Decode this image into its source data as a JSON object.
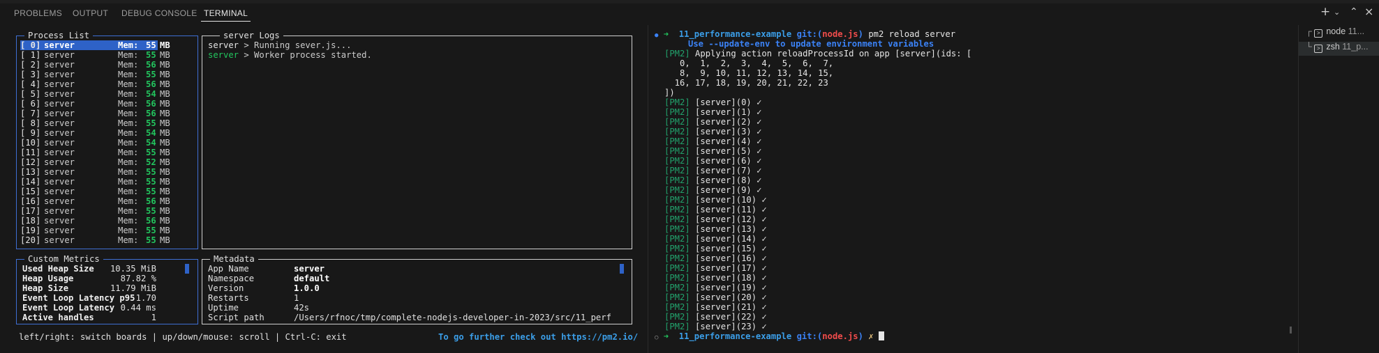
{
  "panel_tabs": [
    "PROBLEMS",
    "OUTPUT",
    "DEBUG CONSOLE",
    "TERMINAL"
  ],
  "top_icons": {
    "add": "+",
    "chevron": "⌄",
    "maximize": "⌃",
    "close": "×"
  },
  "pm2": {
    "process_list": {
      "title": "Process List",
      "rows": [
        {
          "id": "[ 0]",
          "name": "server",
          "mem_label": "Mem:",
          "mem": "55",
          "unit": "MB"
        },
        {
          "id": "[ 1]",
          "name": "server",
          "mem_label": "Mem:",
          "mem": "55",
          "unit": "MB"
        },
        {
          "id": "[ 2]",
          "name": "server",
          "mem_label": "Mem:",
          "mem": "56",
          "unit": "MB"
        },
        {
          "id": "[ 3]",
          "name": "server",
          "mem_label": "Mem:",
          "mem": "55",
          "unit": "MB"
        },
        {
          "id": "[ 4]",
          "name": "server",
          "mem_label": "Mem:",
          "mem": "56",
          "unit": "MB"
        },
        {
          "id": "[ 5]",
          "name": "server",
          "mem_label": "Mem:",
          "mem": "54",
          "unit": "MB"
        },
        {
          "id": "[ 6]",
          "name": "server",
          "mem_label": "Mem:",
          "mem": "56",
          "unit": "MB"
        },
        {
          "id": "[ 7]",
          "name": "server",
          "mem_label": "Mem:",
          "mem": "56",
          "unit": "MB"
        },
        {
          "id": "[ 8]",
          "name": "server",
          "mem_label": "Mem:",
          "mem": "55",
          "unit": "MB"
        },
        {
          "id": "[ 9]",
          "name": "server",
          "mem_label": "Mem:",
          "mem": "54",
          "unit": "MB"
        },
        {
          "id": "[10]",
          "name": "server",
          "mem_label": "Mem:",
          "mem": "54",
          "unit": "MB"
        },
        {
          "id": "[11]",
          "name": "server",
          "mem_label": "Mem:",
          "mem": "55",
          "unit": "MB"
        },
        {
          "id": "[12]",
          "name": "server",
          "mem_label": "Mem:",
          "mem": "52",
          "unit": "MB"
        },
        {
          "id": "[13]",
          "name": "server",
          "mem_label": "Mem:",
          "mem": "55",
          "unit": "MB"
        },
        {
          "id": "[14]",
          "name": "server",
          "mem_label": "Mem:",
          "mem": "55",
          "unit": "MB"
        },
        {
          "id": "[15]",
          "name": "server",
          "mem_label": "Mem:",
          "mem": "55",
          "unit": "MB"
        },
        {
          "id": "[16]",
          "name": "server",
          "mem_label": "Mem:",
          "mem": "56",
          "unit": "MB"
        },
        {
          "id": "[17]",
          "name": "server",
          "mem_label": "Mem:",
          "mem": "55",
          "unit": "MB"
        },
        {
          "id": "[18]",
          "name": "server",
          "mem_label": "Mem:",
          "mem": "56",
          "unit": "MB"
        },
        {
          "id": "[19]",
          "name": "server",
          "mem_label": "Mem:",
          "mem": "55",
          "unit": "MB"
        },
        {
          "id": "[20]",
          "name": "server",
          "mem_label": "Mem:",
          "mem": "55",
          "unit": "MB"
        }
      ]
    },
    "logs": {
      "title": "server Logs",
      "lines": [
        {
          "prefix": "server",
          "text": " > Running sever.js...",
          "prefix_color": "white"
        },
        {
          "prefix": "server",
          "text": " > Worker process started.",
          "prefix_color": "green"
        }
      ]
    },
    "metrics": {
      "title": "Custom Metrics",
      "items": [
        {
          "name": "Used Heap Size",
          "value": "10.35 MiB"
        },
        {
          "name": "Heap Usage",
          "value": "87.82 %"
        },
        {
          "name": "Heap Size",
          "value": "11.79 MiB"
        },
        {
          "name": "Event Loop Latency p95",
          "value": "1.70"
        },
        {
          "name": "Event Loop Latency",
          "value": "0.44 ms"
        },
        {
          "name": "Active handles",
          "value": "1"
        }
      ]
    },
    "metadata": {
      "title": "Metadata",
      "items": [
        {
          "key": "App Name",
          "value": "server",
          "bold": true
        },
        {
          "key": "Namespace",
          "value": "default",
          "bold": true
        },
        {
          "key": "Version",
          "value": "1.0.0",
          "bold": true
        },
        {
          "key": "Restarts",
          "value": "1",
          "bold": false
        },
        {
          "key": "Uptime",
          "value": "42s",
          "bold": false
        },
        {
          "key": "Script path",
          "value": "/Users/rfnoc/tmp/complete-nodejs-developer-in-2023/src/11_perf",
          "bold": false
        }
      ]
    },
    "footer_help": "left/right: switch boards | up/down/mouse: scroll | Ctrl-C: exit",
    "footer_link": "To go further check out https://pm2.io/"
  },
  "terminal": {
    "prompt_dir": "11_performance-example",
    "prompt_git": "git:(",
    "prompt_branch": "node.js",
    "prompt_git_close": ")",
    "command": "pm2 reload server",
    "warning": "Use --update-env to update environment variables",
    "apply_line": "Applying action reloadProcessId on app [server](ids: [",
    "id_lines": [
      "   0,  1,  2,  3,  4,  5,  6,  7,",
      "   8,  9, 10, 11, 12, 13, 14, 15,",
      "  16, 17, 18, 19, 20, 21, 22, 23",
      "])"
    ],
    "pm2_tag": "[PM2]",
    "reloaded": [
      "[server](0) ✓",
      "[server](1) ✓",
      "[server](2) ✓",
      "[server](3) ✓",
      "[server](4) ✓",
      "[server](5) ✓",
      "[server](6) ✓",
      "[server](7) ✓",
      "[server](8) ✓",
      "[server](9) ✓",
      "[server](10) ✓",
      "[server](11) ✓",
      "[server](12) ✓",
      "[server](13) ✓",
      "[server](14) ✓",
      "[server](15) ✓",
      "[server](16) ✓",
      "[server](17) ✓",
      "[server](18) ✓",
      "[server](19) ✓",
      "[server](20) ✓",
      "[server](21) ✓",
      "[server](22) ✓",
      "[server](23) ✓"
    ],
    "last_prompt_suffix": "✗"
  },
  "sidebar": {
    "items": [
      {
        "label": "node",
        "detail": "11..."
      },
      {
        "label": "zsh",
        "detail": "11_p..."
      }
    ]
  }
}
